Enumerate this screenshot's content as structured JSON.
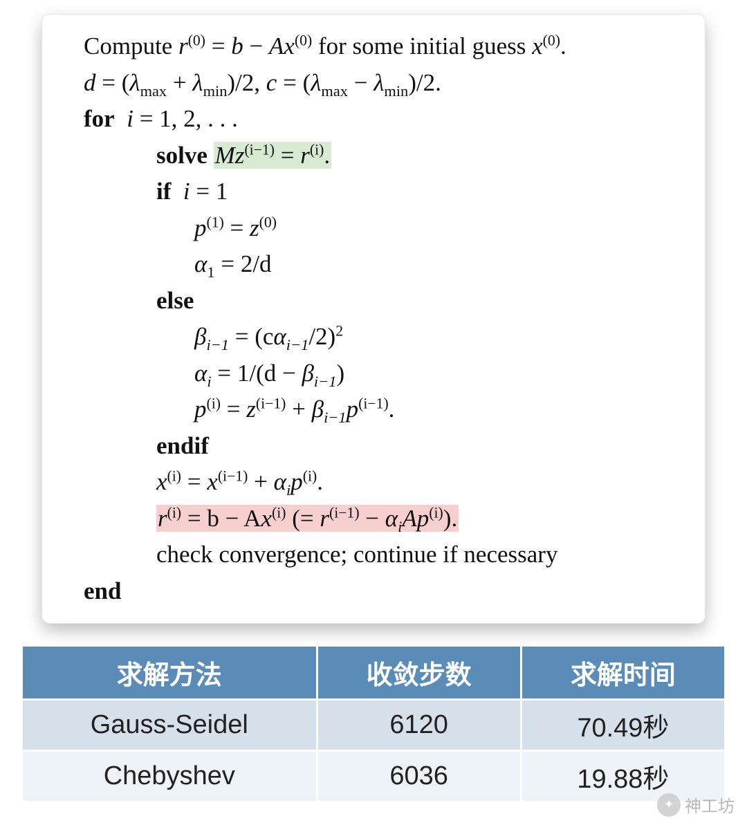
{
  "algorithm": {
    "line_compute_prefix": "Compute ",
    "line_compute_r": "r",
    "sup0": "(0)",
    "eq": " = ",
    "b": "b",
    "minus": " − ",
    "A": "A",
    "x": "x",
    "line_compute_suffix": " for some initial guess ",
    "period": ".",
    "d": "d",
    "lmax": "λ",
    "max": "max",
    "lmin": "λ",
    "min": "min",
    "plus": " + ",
    "over2": ")/2",
    "comma": ", ",
    "c": "c",
    "for": "for",
    "i": "i",
    "forvals": " = 1, 2, . . .",
    "solve": "solve",
    "M": "M",
    "z": "z",
    "sup_im1": "(i−1)",
    "sup_i": "(i)",
    "if": "if",
    "if_cond": " = 1",
    "p": "p",
    "sup1": "(1)",
    "alpha": "α",
    "sub1": "1",
    "twod": " = 2/d",
    "else": "else",
    "beta": "β",
    "sub_im1": "i−1",
    "beta_rhs_open": " = (c",
    "beta_rhs_close": "/2)",
    "sq": "2",
    "alpha_i": "i",
    "alpha_rhs": " = 1/(d − ",
    "close_paren": ")",
    "endif": "endif",
    "x_update": " = ",
    "r_line_open": " = b − A",
    "r_paren_open": "   (= ",
    "Ap": "Ap",
    "check": "check convergence; continue if necessary",
    "end": "end"
  },
  "table": {
    "headers": [
      "求解方法",
      "收敛步数",
      "求解时间"
    ],
    "rows": [
      {
        "method": "Gauss-Seidel",
        "steps": "6120",
        "time": "70.49秒"
      },
      {
        "method": "Chebyshev",
        "steps": "6036",
        "time": "19.88秒"
      }
    ]
  },
  "watermark": {
    "text": "神工坊"
  }
}
